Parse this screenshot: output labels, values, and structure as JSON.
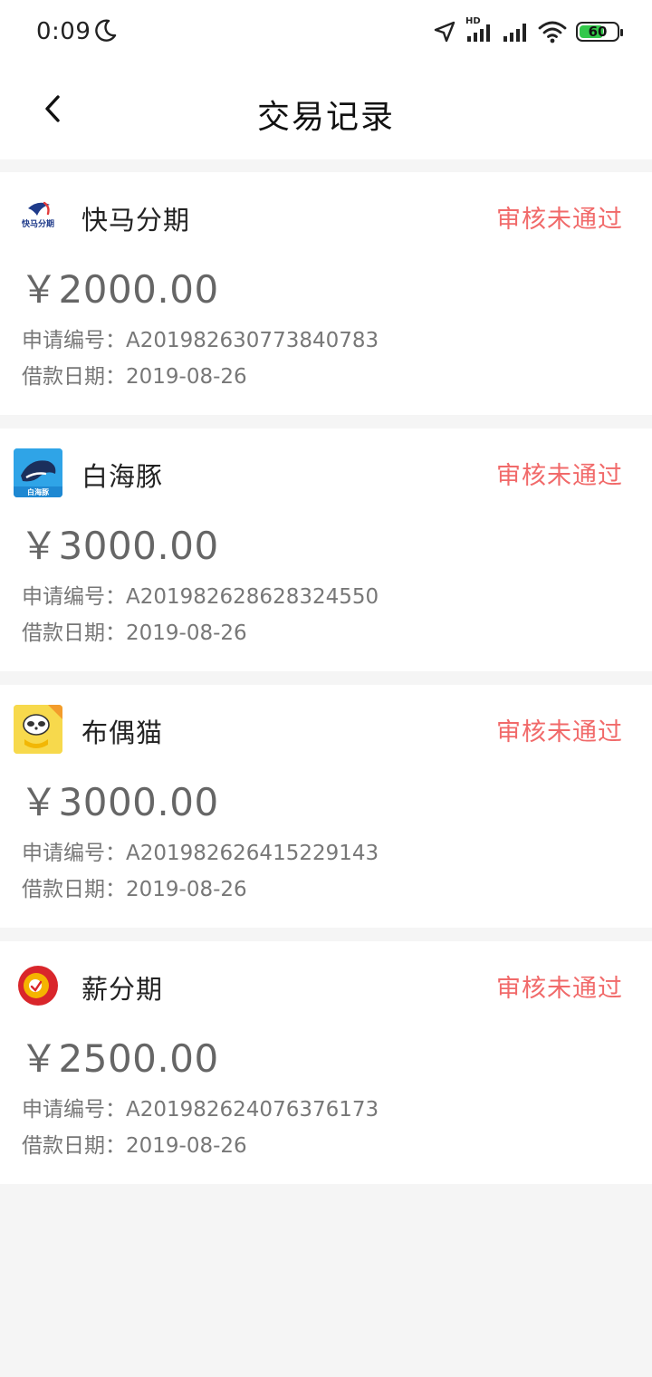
{
  "status_bar": {
    "time": "0:09",
    "hd_label": "HD",
    "battery_level": "60",
    "icons": [
      "moon-icon",
      "location-arrow-icon",
      "signal-hd-icon",
      "signal-icon",
      "wifi-icon",
      "battery-icon"
    ]
  },
  "header": {
    "title": "交易记录",
    "back_icon": "chevron-left-icon"
  },
  "labels": {
    "application_no": "申请编号：",
    "loan_date": "借款日期："
  },
  "colors": {
    "status_red": "#f16a6a",
    "amount_gray": "#666666",
    "background": "#f5f5f5"
  },
  "records": [
    {
      "name": "快马分期",
      "logo_icon": "kuaima-fenqi-logo-icon",
      "logo_text": "快马分期",
      "status": "审核未通过",
      "amount": "￥2000.00",
      "application_no": "A201982630773840783",
      "loan_date": "2019-08-26"
    },
    {
      "name": "白海豚",
      "logo_icon": "dolphin-logo-icon",
      "logo_text": "白海豚",
      "status": "审核未通过",
      "amount": "￥3000.00",
      "application_no": "A201982628628324550",
      "loan_date": "2019-08-26"
    },
    {
      "name": "布偶猫",
      "logo_icon": "cat-logo-icon",
      "status": "审核未通过",
      "amount": "￥3000.00",
      "application_no": "A201982626415229143",
      "loan_date": "2019-08-26"
    },
    {
      "name": "薪分期",
      "logo_icon": "xin-fenqi-logo-icon",
      "status": "审核未通过",
      "amount": "￥2500.00",
      "application_no": "A201982624076376173",
      "loan_date": "2019-08-26"
    }
  ]
}
